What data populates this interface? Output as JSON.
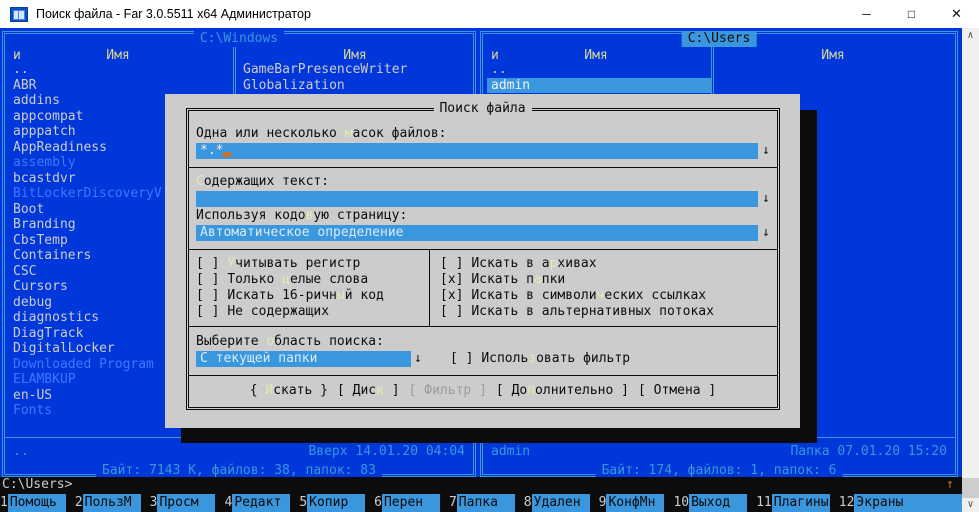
{
  "window": {
    "title": "Поиск файла - Far 3.0.5511 x64 Администратор",
    "controls": {
      "minimize": "─",
      "maximize": "□",
      "close": "✕"
    }
  },
  "left_panel": {
    "title": "C:\\Windows",
    "sort_indicator": "и",
    "col1_header": "Имя",
    "col2_header": "Имя",
    "items": [
      {
        "name": ".."
      },
      {
        "name": "ABR"
      },
      {
        "name": "addins"
      },
      {
        "name": "appcompat"
      },
      {
        "name": "apppatch"
      },
      {
        "name": "AppReadiness"
      },
      {
        "name": "assembly",
        "hidden": true
      },
      {
        "name": "bcastdvr"
      },
      {
        "name": "BitLockerDiscoveryV",
        "hidden": true
      },
      {
        "name": "Boot"
      },
      {
        "name": "Branding"
      },
      {
        "name": "CbsTemp"
      },
      {
        "name": "Containers"
      },
      {
        "name": "CSC"
      },
      {
        "name": "Cursors"
      },
      {
        "name": "debug"
      },
      {
        "name": "diagnostics"
      },
      {
        "name": "DiagTrack"
      },
      {
        "name": "DigitalLocker"
      },
      {
        "name": "Downloaded Program",
        "hidden": true
      },
      {
        "name": "ELAMBKUP",
        "hidden": true
      },
      {
        "name": "en-US"
      },
      {
        "name": "Fonts",
        "hidden": true
      }
    ],
    "items_col2": [
      {
        "name": "GameBarPresenceWriter"
      },
      {
        "name": "Globalization"
      }
    ],
    "status_name": "..",
    "status_info": "Вверх 14.01.20 04:04",
    "summary": "Байт: 7143 K, файлов: 38, папок: 83"
  },
  "right_panel": {
    "title": "C:\\Users",
    "sort_indicator": "и",
    "col1_header": "Имя",
    "col2_header": "Имя",
    "items": [
      {
        "name": ".."
      },
      {
        "name": "admin",
        "selected": true
      }
    ],
    "items_col2": [],
    "status_name": "admin",
    "status_info": "Папка 07.01.20 15:20",
    "summary": "Байт: 174, файлов: 1, папок: 6"
  },
  "dialog": {
    "title": "Поиск файла",
    "history_arrow": "↓",
    "mask": {
      "label": {
        "pre": "Одна или несколько ",
        "hot": "м",
        "post": "асок файлов:"
      },
      "value": "*.*"
    },
    "text": {
      "label": {
        "pre": "",
        "hot": "С",
        "post": "одержащих текст:"
      },
      "value": ""
    },
    "codepage": {
      "label": {
        "pre": "Используя кодо",
        "hot": "в",
        "post": "ую страницу:"
      },
      "value": "Автоматическое определение"
    },
    "checks_left": [
      {
        "mark": "[ ]",
        "pre": "",
        "hot": "У",
        "post": "читывать регистр"
      },
      {
        "mark": "[ ]",
        "pre": "Только ",
        "hot": "ц",
        "post": "елые слова"
      },
      {
        "mark": "[ ]",
        "pre": "Искать 16-ричн",
        "hot": "ы",
        "post": "й код"
      },
      {
        "mark": "[ ]",
        "pre": "Не содержащих",
        "hot": "",
        "post": ""
      }
    ],
    "checks_right": [
      {
        "mark": "[ ]",
        "pre": "Искать в а",
        "hot": "р",
        "post": "хивах"
      },
      {
        "mark": "[x]",
        "pre": "Искать п",
        "hot": "а",
        "post": "пки"
      },
      {
        "mark": "[x]",
        "pre": "Искать в символи",
        "hot": "ч",
        "post": "еских ссылках"
      },
      {
        "mark": "[ ]",
        "pre": "Искать в альтернативных потоках",
        "hot": "",
        "post": ""
      }
    ],
    "area": {
      "label": {
        "pre": "Выберите ",
        "hot": "о",
        "post": "бласть поиска:"
      },
      "value": "С текущей папки"
    },
    "filter_check": {
      "mark": "[ ]",
      "pre": "Исполь",
      "hot": "з",
      "post": "овать фильтр"
    },
    "buttons": [
      {
        "lb": "{ ",
        "pre": "",
        "hot": "И",
        "post": "скать",
        "rb": " }",
        "disabled": false
      },
      {
        "lb": "[ ",
        "pre": "Дис",
        "hot": "к",
        "post": "",
        "rb": " ]",
        "disabled": false
      },
      {
        "lb": "[ ",
        "pre": "Фильтр",
        "hot": "",
        "post": "",
        "rb": " ]",
        "disabled": true
      },
      {
        "lb": "[ ",
        "pre": "До",
        "hot": "п",
        "post": "олнительно",
        "rb": " ]",
        "disabled": false
      },
      {
        "lb": "[ ",
        "pre": "Отмена",
        "hot": "",
        "post": "",
        "rb": " ]",
        "disabled": false
      }
    ]
  },
  "command_line": {
    "prompt": "C:\\Users>",
    "screen_arrow": "↑"
  },
  "keybar": [
    {
      "num": "1",
      "label": "Помощь"
    },
    {
      "num": "2",
      "label": "ПользМ"
    },
    {
      "num": "3",
      "label": "Просм"
    },
    {
      "num": "4",
      "label": "Редакт"
    },
    {
      "num": "5",
      "label": "Копир"
    },
    {
      "num": "6",
      "label": "Перен"
    },
    {
      "num": "7",
      "label": "Папка"
    },
    {
      "num": "8",
      "label": "Удален"
    },
    {
      "num": "9",
      "label": "КонфМн"
    },
    {
      "num": "10",
      "label": "Выход"
    },
    {
      "num": "11",
      "label": "Плагины"
    },
    {
      "num": "12",
      "label": "Экраны"
    }
  ],
  "scrollbar": {
    "up": "∧",
    "down": "∨"
  },
  "colors": {
    "console_blue": "#0037DA",
    "panel_cyan": "#3A96DD",
    "hidden_blue": "#3B78FF",
    "dialog_gray": "#CCCCCC",
    "hotkey_yellow": "#E9E9AF",
    "header_yellow": "#D6D696",
    "cursor_orange": "#C8722C",
    "black": "#0C0C0C",
    "white": "#CCCCCC"
  }
}
